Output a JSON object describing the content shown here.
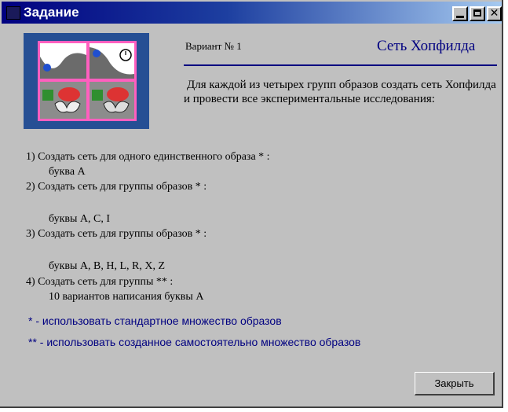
{
  "window": {
    "title": "Задание",
    "controls": {
      "minimize": "minimize-icon",
      "maximize": "maximize-icon",
      "close": "close-icon"
    }
  },
  "header": {
    "variant": "Вариант № 1",
    "network_title": "Сеть Хопфилда",
    "intro": "Для каждой из четырех групп образов создать сеть Хопфилда и провести все экспериментальные исследования:"
  },
  "tasks": [
    {
      "label": "1) Создать сеть для одного единственного образа * :",
      "detail": "буква А"
    },
    {
      "label": "2) Создать сеть для группы образов * :",
      "detail": "буквы A, C, I"
    },
    {
      "label": "3) Создать сеть для группы образов * :",
      "detail": "буквы A, B, H, L, R, X, Z"
    },
    {
      "label": "4) Создать сеть для группы ** :",
      "detail": "10 вариантов написания буквы А"
    }
  ],
  "notes": [
    "* -  использовать стандартное множество образов",
    "** -  использовать созданное самостоятельно множество образов"
  ],
  "buttons": {
    "close_label": "Закрыть"
  },
  "colors": {
    "title_bar": "#000080",
    "accent_text": "#000080",
    "background": "#c0c0c0"
  }
}
